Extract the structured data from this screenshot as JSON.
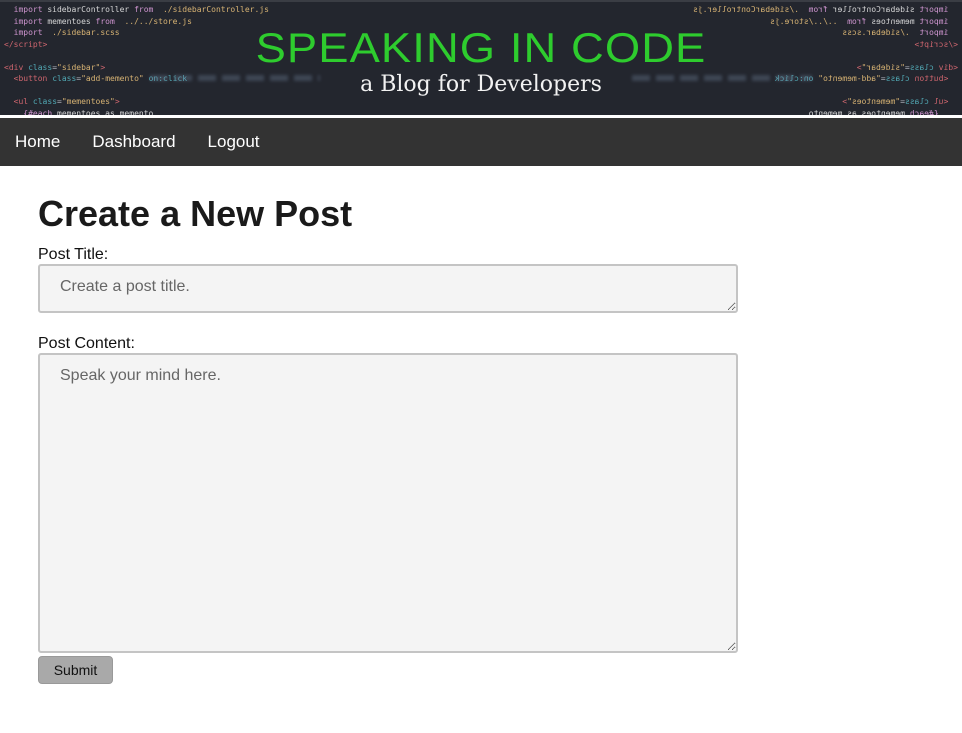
{
  "banner": {
    "title": "SPEAKING IN CODE",
    "subtitle": "a Blog for Developers",
    "title_color": "#2ecc2e",
    "background_color": "#23262e"
  },
  "nav": {
    "items": [
      {
        "label": "Home"
      },
      {
        "label": "Dashboard"
      },
      {
        "label": "Logout"
      }
    ],
    "background_color": "#333333"
  },
  "form": {
    "heading": "Create a New Post",
    "title_label": "Post Title:",
    "title_placeholder": "Create a post title.",
    "title_value": "",
    "content_label": "Post Content:",
    "content_placeholder": "Speak your mind here.",
    "content_value": "",
    "submit_label": "Submit"
  }
}
